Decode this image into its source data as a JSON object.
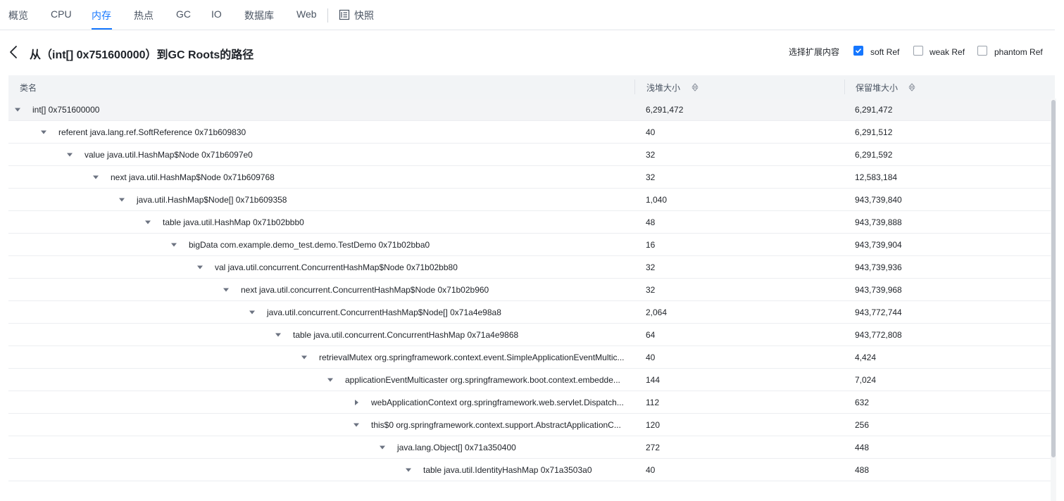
{
  "tabs": [
    {
      "label": "概览"
    },
    {
      "label": "CPU"
    },
    {
      "label": "内存"
    },
    {
      "label": "热点"
    },
    {
      "label": "GC"
    },
    {
      "label": "IO"
    },
    {
      "label": "数据库"
    },
    {
      "label": "Web"
    },
    {
      "label": "快照"
    }
  ],
  "active_tab": "内存",
  "title": "从（int[] 0x751600000）到GC Roots的路径",
  "expand_options": {
    "label": "选择扩展内容",
    "options": [
      {
        "label": "soft Ref",
        "checked": true
      },
      {
        "label": "weak Ref",
        "checked": false
      },
      {
        "label": "phantom Ref",
        "checked": false
      }
    ]
  },
  "table": {
    "columns": [
      "类名",
      "浅堆大小",
      "保留堆大小"
    ],
    "rows": [
      {
        "name": "int[] 0x751600000",
        "shallow": "6,291,472",
        "retained": "6,291,472",
        "depth": 0,
        "expanded": true
      },
      {
        "name": "referent java.lang.ref.SoftReference 0x71b609830",
        "shallow": "40",
        "retained": "6,291,512",
        "depth": 1,
        "expanded": true
      },
      {
        "name": "value java.util.HashMap$Node 0x71b6097e0",
        "shallow": "32",
        "retained": "6,291,592",
        "depth": 2,
        "expanded": true
      },
      {
        "name": "next java.util.HashMap$Node 0x71b609768",
        "shallow": "32",
        "retained": "12,583,184",
        "depth": 3,
        "expanded": true
      },
      {
        "name": "java.util.HashMap$Node[] 0x71b609358",
        "shallow": "1,040",
        "retained": "943,739,840",
        "depth": 4,
        "expanded": true
      },
      {
        "name": "table java.util.HashMap 0x71b02bbb0",
        "shallow": "48",
        "retained": "943,739,888",
        "depth": 5,
        "expanded": true
      },
      {
        "name": "bigData com.example.demo_test.demo.TestDemo 0x71b02bba0",
        "shallow": "16",
        "retained": "943,739,904",
        "depth": 6,
        "expanded": true
      },
      {
        "name": "val java.util.concurrent.ConcurrentHashMap$Node 0x71b02bb80",
        "shallow": "32",
        "retained": "943,739,936",
        "depth": 7,
        "expanded": true
      },
      {
        "name": "next java.util.concurrent.ConcurrentHashMap$Node 0x71b02b960",
        "shallow": "32",
        "retained": "943,739,968",
        "depth": 8,
        "expanded": true
      },
      {
        "name": "java.util.concurrent.ConcurrentHashMap$Node[] 0x71a4e98a8",
        "shallow": "2,064",
        "retained": "943,772,744",
        "depth": 9,
        "expanded": true
      },
      {
        "name": "table java.util.concurrent.ConcurrentHashMap 0x71a4e9868",
        "shallow": "64",
        "retained": "943,772,808",
        "depth": 10,
        "expanded": true
      },
      {
        "name": "retrievalMutex org.springframework.context.event.SimpleApplicationEventMultic...",
        "shallow": "40",
        "retained": "4,424",
        "depth": 11,
        "expanded": true
      },
      {
        "name": "applicationEventMulticaster org.springframework.boot.context.embedde...",
        "shallow": "144",
        "retained": "7,024",
        "depth": 12,
        "expanded": true
      },
      {
        "name": "webApplicationContext org.springframework.web.servlet.Dispatch...",
        "shallow": "112",
        "retained": "632",
        "depth": 13,
        "expanded": false
      },
      {
        "name": "this$0 org.springframework.context.support.AbstractApplicationC...",
        "shallow": "120",
        "retained": "256",
        "depth": 13,
        "expanded": true
      },
      {
        "name": "java.lang.Object[] 0x71a350400",
        "shallow": "272",
        "retained": "448",
        "depth": 14,
        "expanded": true
      },
      {
        "name": "table java.util.IdentityHashMap 0x71a3503a0",
        "shallow": "40",
        "retained": "488",
        "depth": 15,
        "expanded": true
      }
    ]
  }
}
